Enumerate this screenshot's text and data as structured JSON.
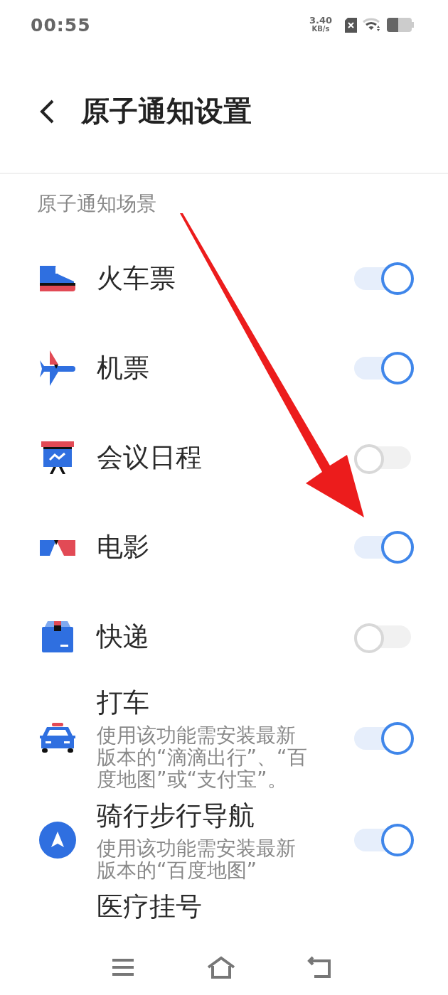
{
  "status_bar": {
    "time": "00:55",
    "network_speed": "3.40",
    "network_speed_unit": "KB/s"
  },
  "header": {
    "title": "原子通知设置"
  },
  "section": {
    "title": "原子通知场景"
  },
  "items": [
    {
      "title": "火车票",
      "on": true
    },
    {
      "title": "机票",
      "on": true
    },
    {
      "title": "会议日程",
      "on": false
    },
    {
      "title": "电影",
      "on": true
    },
    {
      "title": "快递",
      "on": false
    },
    {
      "title": "打车",
      "description": "使用该功能需安装最新版本的“滴滴出行”、“百度地图”或“支付宝”。",
      "on": true
    },
    {
      "title": "骑行步行导航",
      "description": "使用该功能需安装最新版本的“百度地图”",
      "on": true
    },
    {
      "title": "医疗挂号"
    }
  ]
}
